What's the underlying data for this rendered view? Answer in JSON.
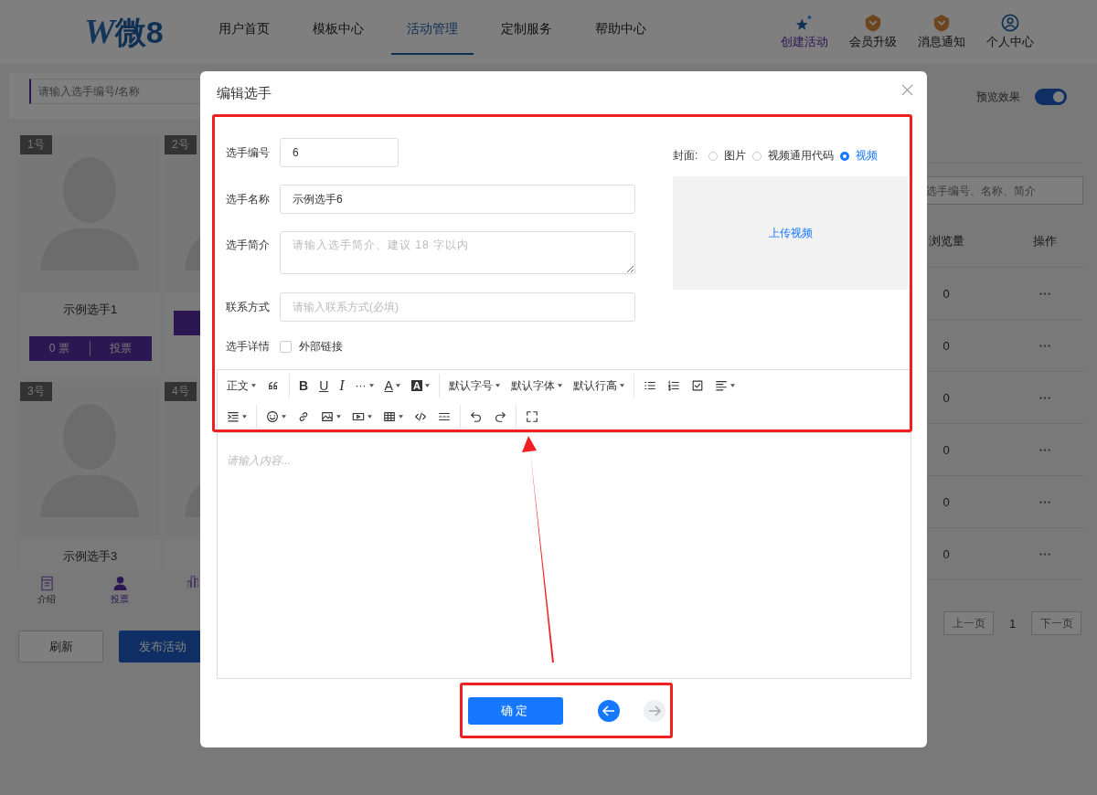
{
  "header": {
    "logo": {
      "mark": "W",
      "text": "微8"
    },
    "nav": [
      {
        "label": "用户首页",
        "selected": false
      },
      {
        "label": "模板中心",
        "selected": false
      },
      {
        "label": "活动管理",
        "selected": true
      },
      {
        "label": "定制服务",
        "selected": false
      },
      {
        "label": "帮助中心",
        "selected": false
      }
    ],
    "actions": [
      {
        "label": "创建活动",
        "kind": "stars",
        "selected": true
      },
      {
        "label": "会员升级",
        "kind": "badge",
        "selected": false
      },
      {
        "label": "消息通知",
        "kind": "badge",
        "selected": false
      },
      {
        "label": "个人中心",
        "kind": "user",
        "selected": false
      }
    ]
  },
  "left_panel": {
    "search_placeholder": "请输入选手编号/名称",
    "cards": [
      {
        "badge": "1号",
        "name": "示例选手1",
        "votes": "0 票",
        "vote_button": "投票",
        "vote_bar": true
      },
      {
        "badge": "2号",
        "vote_bar": true
      },
      {
        "badge": "3号",
        "name": "示例选手3"
      },
      {
        "badge": "4号"
      }
    ],
    "tabs": [
      {
        "label": "介绍",
        "kind": "doc",
        "selected": false
      },
      {
        "label": "投票",
        "kind": "user",
        "selected": true
      },
      {
        "kind": "chart",
        "selected": false
      }
    ],
    "buttons": [
      {
        "label": "刷新",
        "kind": "default"
      },
      {
        "label": "发布活动",
        "kind": "primary"
      }
    ]
  },
  "right_panel": {
    "preview": {
      "label": "预览效果",
      "on": true
    },
    "search_placeholder": "选手编号、名称、简介",
    "columns": [
      "浏览量",
      "操作"
    ],
    "rows": [
      {
        "views": "0"
      },
      {
        "views": "0"
      },
      {
        "views": "0"
      },
      {
        "views": "0"
      },
      {
        "views": "0"
      },
      {
        "views": "0"
      }
    ],
    "pagination": {
      "prev": "上一页",
      "page": "1",
      "next": "下一页"
    }
  },
  "modal": {
    "title": "编辑选手",
    "fields": [
      {
        "label": "选手编号",
        "value": "6",
        "kind": "short"
      },
      {
        "label": "选手名称",
        "value": "示例选手6",
        "kind": "text"
      },
      {
        "label": "选手简介",
        "placeholder": "请输入选手简介、建议 18 字以内",
        "kind": "textarea"
      },
      {
        "label": "联系方式",
        "placeholder": "请输入联系方式(必填)",
        "kind": "text"
      }
    ],
    "details": {
      "label": "选手详情",
      "checkbox_label": "外部链接",
      "checked": false
    },
    "cover": {
      "label": "封面:",
      "options": [
        {
          "label": "图片",
          "selected": false
        },
        {
          "label": "视频通用代码",
          "selected": false
        },
        {
          "label": "视频",
          "selected": true
        }
      ],
      "upload": "上传视频"
    },
    "toolbar": [
      [
        [
          {
            "kind": "heading",
            "label": "正文",
            "caret": true
          },
          {
            "kind": "quote"
          }
        ],
        [
          {
            "kind": "bold",
            "label": "B"
          },
          {
            "kind": "underline",
            "label": "U"
          },
          {
            "kind": "italic",
            "label": "I"
          },
          {
            "kind": "more",
            "label": "···",
            "caret": true
          },
          {
            "kind": "font-color",
            "label": "A",
            "caret": true
          },
          {
            "kind": "bg-color",
            "label": "A",
            "caret": true
          }
        ],
        [
          {
            "kind": "text",
            "label": "默认字号",
            "caret": true
          },
          {
            "kind": "text",
            "label": "默认字体",
            "caret": true
          },
          {
            "kind": "text",
            "label": "默认行高",
            "caret": true
          }
        ],
        [
          {
            "kind": "bullet-list"
          },
          {
            "kind": "numbered-list"
          },
          {
            "kind": "todo"
          },
          {
            "kind": "align",
            "caret": true
          }
        ]
      ],
      [
        [
          {
            "kind": "indent",
            "caret": true
          }
        ],
        [
          {
            "kind": "emoji",
            "caret": true
          },
          {
            "kind": "link"
          },
          {
            "kind": "image",
            "caret": true
          },
          {
            "kind": "video",
            "caret": true
          },
          {
            "kind": "table",
            "caret": true
          },
          {
            "kind": "code"
          },
          {
            "kind": "divider"
          }
        ],
        [
          {
            "kind": "undo"
          },
          {
            "kind": "redo"
          }
        ],
        [
          {
            "kind": "fullscreen"
          }
        ]
      ]
    ],
    "editor_placeholder": "请输入内容...",
    "confirm": "确定",
    "nav": [
      {
        "kind": "previous",
        "disabled": false
      },
      {
        "kind": "next",
        "disabled": true
      }
    ]
  }
}
